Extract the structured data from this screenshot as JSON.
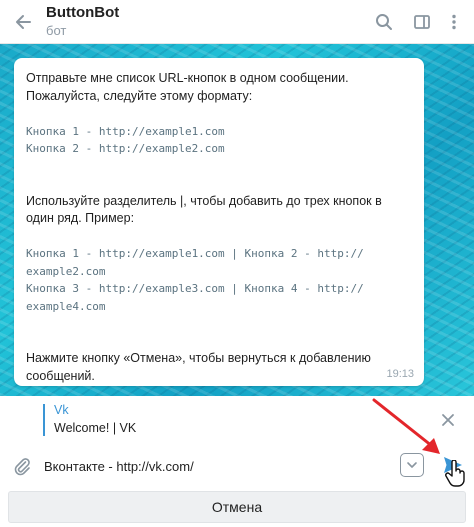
{
  "header": {
    "title": "ButtonBot",
    "subtitle": "бот",
    "icons": [
      "back-arrow-icon",
      "search-icon",
      "sidebar-toggle-icon",
      "more-icon"
    ]
  },
  "message": {
    "lines": [
      {
        "style": "text",
        "content": "Отправьте мне список URL-кнопок в одном сообщении."
      },
      {
        "style": "text",
        "content": "Пожалуйста, следуйте этому формату:"
      },
      {
        "style": "gap",
        "content": ""
      },
      {
        "style": "code",
        "content": "Кнопка 1 - http://example1.com"
      },
      {
        "style": "code",
        "content": "Кнопка 2 - http://example2.com"
      },
      {
        "style": "gap",
        "content": ""
      },
      {
        "style": "gap",
        "content": ""
      },
      {
        "style": "text",
        "content": "Используйте разделитель |, чтобы добавить до трех кнопок в"
      },
      {
        "style": "text",
        "content": "один ряд. Пример:"
      },
      {
        "style": "gap",
        "content": ""
      },
      {
        "style": "code",
        "content": "Кнопка 1 - http://example1.com | Кнопка 2 - http://"
      },
      {
        "style": "code",
        "content": "example2.com"
      },
      {
        "style": "code",
        "content": "Кнопка 3 - http://example3.com | Кнопка 4 - http://"
      },
      {
        "style": "code",
        "content": "example4.com"
      },
      {
        "style": "gap",
        "content": ""
      },
      {
        "style": "gap",
        "content": ""
      },
      {
        "style": "text",
        "content": "Нажмите кнопку «Отмена», чтобы вернуться к добавлению"
      },
      {
        "style": "text",
        "content": "сообщений."
      }
    ],
    "time": "19:13"
  },
  "reply": {
    "name": "Vk",
    "text": "Welcome! | VK"
  },
  "input": {
    "value": "Вконтакте - http://vk.com/"
  },
  "cancel_label": "Отмена",
  "colors": {
    "accent": "#3a95d5",
    "arrow": "#e3262b"
  }
}
